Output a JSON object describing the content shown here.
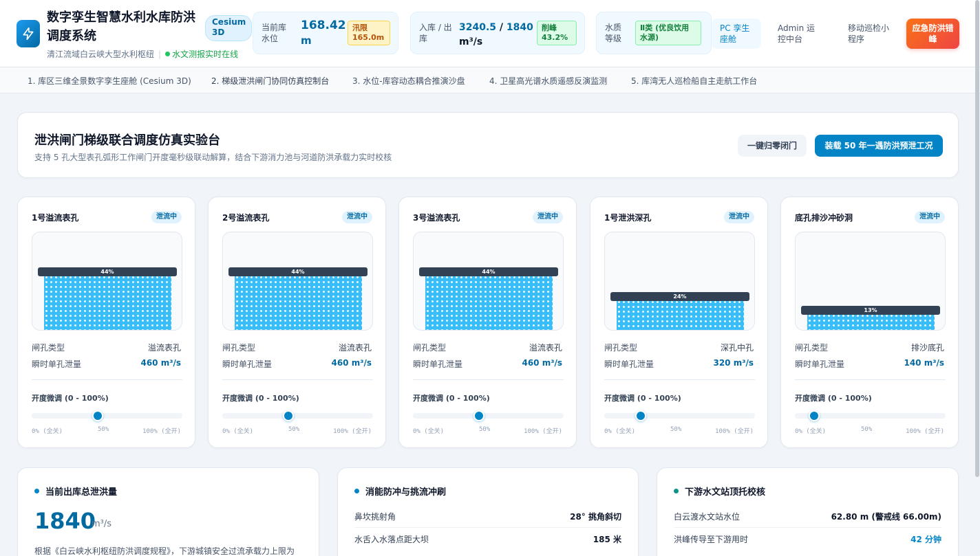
{
  "app": {
    "title": "数字孪生智慧水利水库防洪调度系统",
    "subtitle": "清江流域白云峡大型水利枢纽",
    "live_status": "水文测报实时在线",
    "engine_tag": "Cesium 3D"
  },
  "stats": {
    "water_level": {
      "label": "当前库水位",
      "value": "168.42",
      "unit": "m",
      "badge": "汛限 165.0m"
    },
    "flow": {
      "label": "入库 / 出库",
      "inflow": "3240.5",
      "separator": " / ",
      "outflow": "1840",
      "unit": "m³/s",
      "badge": "削峰 43.2%"
    },
    "water_quality": {
      "label": "水质等级",
      "badge": "Ⅱ类 (优良饮用水源)"
    }
  },
  "nav": {
    "pc_cockpit": "PC 孪生座舱",
    "admin": "Admin 运控中台",
    "mobile": "移动巡检小程序",
    "emergency": "应急防洪错峰"
  },
  "tabs": [
    "1. 库区三维全景数字孪生座舱 (Cesium 3D)",
    "2. 梯级泄洪闸门协同仿真控制台",
    "3. 水位-库容动态耦合推演沙盘",
    "4. 卫星高光谱水质遥感反演监测",
    "5. 库湾无人巡检船自主走航工作台"
  ],
  "hero": {
    "title": "泄洪闸门梯级联合调度仿真实验台",
    "description": "支持 5 孔大型表孔弧形工作闸门开度毫秒级联动解算，结合下游消力池与河道防洪承载力实时校核",
    "reset_button": "一键归零闭门",
    "load_button": "装载 50 年一遇防洪预泄工况"
  },
  "gate_common": {
    "type_label": "闸孔类型",
    "flow_label": "瞬时单孔泄量",
    "slider_label": "开度微调 (0 - 100%)",
    "tick_min": "0% (全关)",
    "tick_mid": "50%",
    "tick_max": "100% (全开)",
    "status": "泄流中"
  },
  "gates": [
    {
      "name": "1号溢流表孔",
      "type": "溢流表孔",
      "flow": "460 m³/s",
      "opening": 44,
      "opening_label": "44%"
    },
    {
      "name": "2号溢流表孔",
      "type": "溢流表孔",
      "flow": "460 m³/s",
      "opening": 44,
      "opening_label": "44%"
    },
    {
      "name": "3号溢流表孔",
      "type": "溢流表孔",
      "flow": "460 m³/s",
      "opening": 44,
      "opening_label": "44%"
    },
    {
      "name": "1号泄洪深孔",
      "type": "深孔中孔",
      "flow": "320 m³/s",
      "opening": 24,
      "opening_label": "24%"
    },
    {
      "name": "底孔排沙冲砂洞",
      "type": "排沙底孔",
      "flow": "140 m³/s",
      "opening": 13,
      "opening_label": "13%"
    }
  ],
  "summary": {
    "title": "当前出库总泄洪量",
    "value": "1840",
    "unit": "m³/s",
    "note": "根据《白云峡水利枢纽防洪调度规程》，下游城镇安全过流承载力上限为"
  },
  "energy": {
    "title": "消能防冲与挑流冲刷",
    "rows": [
      {
        "label": "鼻坎挑射角",
        "value": "28° 挑角斜切"
      },
      {
        "label": "水舌入水落点距大坝",
        "value": "185 米"
      }
    ]
  },
  "downstream": {
    "title": "下游水文站顶托校核",
    "rows": [
      {
        "label": "白云渡水文站水位",
        "value": "62.80 m (警戒线 66.00m)"
      },
      {
        "label": "洪峰传导至下游用时",
        "value": "42 分钟"
      }
    ]
  },
  "colors": {
    "accent": "#0284c7",
    "water": "#38bdf8",
    "gate": "#334155",
    "emergency_start": "#f97316",
    "emergency_end": "#ef4444",
    "live": "#22c55e"
  },
  "icons": {
    "logo": "lightning-icon"
  }
}
